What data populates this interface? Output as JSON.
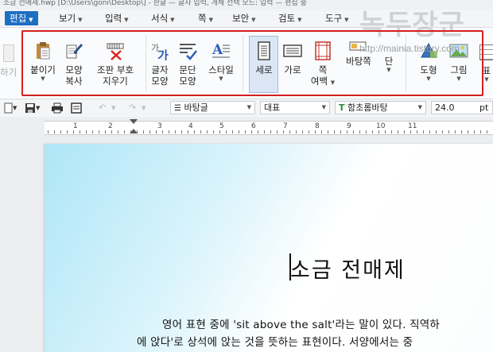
{
  "window": {
    "title_strip": "소금 전매제.hwp [D:\\Users\\goni\\Desktop\\] - 한글 — 글자 입력, 개체 선택 모드: 입력 — 편집 중"
  },
  "menu": {
    "items": [
      {
        "label": "편집",
        "has_arrow": true,
        "active": true
      },
      {
        "label": "보기",
        "has_arrow": true
      },
      {
        "label": "입력",
        "has_arrow": true
      },
      {
        "label": "서식",
        "has_arrow": true
      },
      {
        "label": "쪽",
        "has_arrow": true
      },
      {
        "label": "보안",
        "has_arrow": true
      },
      {
        "label": "검토",
        "has_arrow": true
      },
      {
        "label": "도구",
        "has_arrow": true
      }
    ]
  },
  "ribbon": {
    "left_partial": "하기",
    "buttons": [
      {
        "name": "paste",
        "line1": "붙이기",
        "line2": "",
        "arrow": true
      },
      {
        "name": "format-copy",
        "line1": "모양",
        "line2": "복사",
        "arrow": false
      },
      {
        "name": "clear-marks",
        "line1": "조판 부호",
        "line2": "지우기",
        "arrow": false
      },
      {
        "name": "char-shape",
        "line1": "글자",
        "line2": "모양",
        "arrow": false
      },
      {
        "name": "para-shape",
        "line1": "문단",
        "line2": "모양",
        "arrow": false
      },
      {
        "name": "style",
        "line1": "스타일",
        "line2": "",
        "arrow": true
      },
      {
        "name": "portrait",
        "line1": "세로",
        "line2": "",
        "arrow": false,
        "selected": true
      },
      {
        "name": "landscape",
        "line1": "가로",
        "line2": "",
        "arrow": false
      },
      {
        "name": "margins",
        "line1": "쪽",
        "line2": "여백",
        "arrow": true
      },
      {
        "name": "background",
        "line1": "바탕쪽",
        "line2": "",
        "arrow": false
      },
      {
        "name": "columns",
        "line1": "단",
        "line2": "",
        "arrow": true
      },
      {
        "name": "shapes",
        "line1": "도형",
        "line2": "",
        "arrow": true
      },
      {
        "name": "picture",
        "line1": "그림",
        "line2": "",
        "arrow": true
      },
      {
        "name": "table",
        "line1": "표",
        "line2": "",
        "arrow": true
      }
    ]
  },
  "watermark": {
    "title": "녹두장군",
    "url": "http://mainia.tistory.com"
  },
  "toolbar": {
    "style_select": "바탕글",
    "language_select": "대표",
    "font_select": "함초롬바탕",
    "font_size": "24.0",
    "unit": "pt"
  },
  "ruler": {
    "numbers": [
      "1",
      "2",
      "3",
      "4",
      "5",
      "6",
      "7",
      "8",
      "9",
      "10",
      "11"
    ]
  },
  "document": {
    "title": "소금 전매제",
    "line1": "영어 표현 중에 'sit above the salt'라는 말이 있다. 직역하",
    "line2": "에 앉다'로 상석에 앉는 것을 뜻하는 표현이다. 서양에서는 중"
  },
  "colors": {
    "accent": "#1d6fc2",
    "highlight_box": "#d32020",
    "selected_bg": "#dbe7f5"
  }
}
